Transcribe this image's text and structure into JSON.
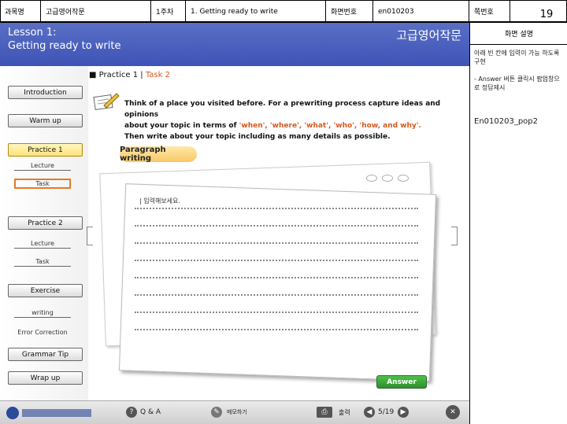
{
  "meta": {
    "subject_label": "과목명",
    "subject_value": "고급영어작문",
    "week": "1주차",
    "lesson_name": "1. Getting ready to write",
    "screen_no_label": "화면번호",
    "screen_no_value": "en010203",
    "page_label": "쪽번호",
    "page_value": "19"
  },
  "header": {
    "lesson_line1": "Lesson 1:",
    "lesson_line2": "Getting ready to write",
    "course_title": "고급영어작문"
  },
  "sidebar": {
    "items": [
      {
        "label": "Introduction"
      },
      {
        "label": "Warm up"
      },
      {
        "label": "Practice 1"
      },
      {
        "label": "Practice 2"
      },
      {
        "label": "Exercise"
      },
      {
        "label": "Grammar Tip"
      },
      {
        "label": "Wrap up"
      }
    ],
    "p1_sub": [
      "Lecture",
      "Task"
    ],
    "p2_sub": [
      "Lecture",
      "Task"
    ],
    "ex_sub": [
      "writing",
      "Error Correction"
    ]
  },
  "content": {
    "section_prefix": "■ Practice 1  |  ",
    "section_task": "Task 2",
    "instr_1": "Think of a place you visited before. For a prewriting process capture ideas and opinions",
    "instr_2a": "about your topic in terms of  ",
    "instr_2b": "'when', 'where', 'what', 'who', 'how, and why'.",
    "instr_3": "Then write about your topic including as many details as possible.",
    "para_tab": "Paragraph writing",
    "hint": "| 입력해보세요.",
    "answer_label": "Answer"
  },
  "footer": {
    "qa": "Q & A",
    "memo": "메모하기",
    "print": "출력",
    "page": "5/19"
  },
  "right_panel": {
    "title": "화면 설명",
    "note1": "아래 빈 칸에 입력이 가능 하도록 구현",
    "note2": "- Answer 버튼 클릭시 팝업창으로 정답제시",
    "popup": "En010203_pop2"
  }
}
